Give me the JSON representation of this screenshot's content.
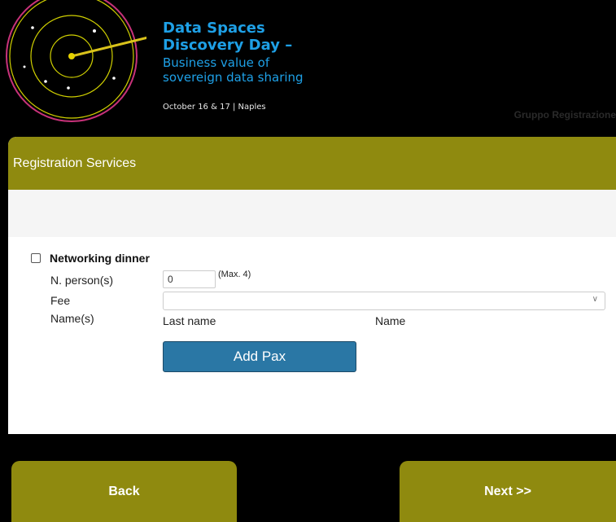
{
  "header": {
    "title_line1": "Data Spaces",
    "title_line2": "Discovery Day –",
    "subtitle_line1": "Business value of",
    "subtitle_line2": "sovereign data sharing",
    "date": "October 16 & 17 | Naples",
    "ghost_text": "Gruppo Registrazione"
  },
  "card": {
    "section_title": "Registration Services"
  },
  "service": {
    "checkbox_label": "Networking dinner",
    "checked": false,
    "persons_label": "N. person(s)",
    "persons_value": "0",
    "max_note": "(Max. 4)",
    "fee_label": "Fee",
    "fee_value": "",
    "names_label": "Name(s)",
    "col_last_name": "Last name",
    "col_name": "Name",
    "add_button": "Add Pax"
  },
  "footer": {
    "back": "Back",
    "next": "Next >>"
  },
  "colors": {
    "accent_olive": "#8f8a0f",
    "button_blue": "#2a77a5",
    "title_blue": "#1ea0e6"
  },
  "icons": {
    "logo": "radar-logo-icon",
    "chevron": "chevron-down-icon"
  }
}
